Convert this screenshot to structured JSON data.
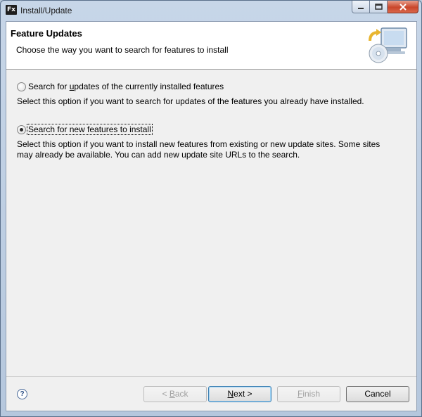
{
  "window": {
    "title": "Install/Update",
    "app_icon_text": "Fx"
  },
  "header": {
    "title": "Feature Updates",
    "description": "Choose the way you want to search for features to install"
  },
  "options": [
    {
      "label_pre": "Search for ",
      "label_mnemonic": "u",
      "label_post": "pdates of the currently installed features",
      "selected": false,
      "description": "Select this option if you want to search for updates of the features you already have installed."
    },
    {
      "label": "Search for new features to install",
      "selected": true,
      "description": "Select this option if you want to install new features from existing or new update sites. Some sites may already be available. You can add new update site URLs to the search."
    }
  ],
  "footer": {
    "help_glyph": "?",
    "back": {
      "pre": "< ",
      "mnemonic": "B",
      "post": "ack",
      "enabled": false
    },
    "next": {
      "pre": "",
      "mnemonic": "N",
      "post": "ext >",
      "enabled": true
    },
    "finish": {
      "pre": "",
      "mnemonic": "F",
      "post": "inish",
      "enabled": false
    },
    "cancel": {
      "label": "Cancel",
      "enabled": true
    }
  },
  "icons": {
    "header_graphic": "install-update-wizard-icon",
    "help": "help-icon"
  }
}
